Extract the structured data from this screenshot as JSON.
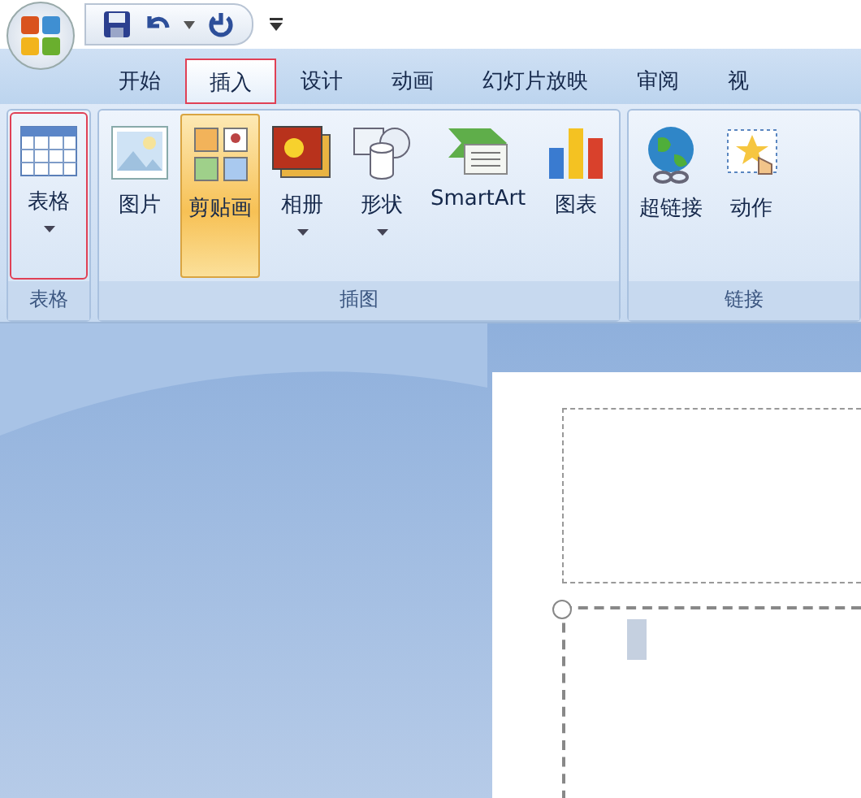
{
  "tabs": [
    {
      "label": "开始",
      "selected": false,
      "marked": false
    },
    {
      "label": "插入",
      "selected": true,
      "marked": true
    },
    {
      "label": "设计",
      "selected": false,
      "marked": false
    },
    {
      "label": "动画",
      "selected": false,
      "marked": false
    },
    {
      "label": "幻灯片放映",
      "selected": false,
      "marked": false
    },
    {
      "label": "审阅",
      "selected": false,
      "marked": false
    },
    {
      "label": "视",
      "selected": false,
      "marked": false
    }
  ],
  "groups": [
    {
      "label": "表格",
      "buttons": [
        {
          "label": "表格",
          "kind": "table",
          "dropdown": true,
          "selected": false,
          "marked": true
        }
      ]
    },
    {
      "label": "插图",
      "buttons": [
        {
          "label": "图片",
          "kind": "picture",
          "dropdown": false,
          "selected": false,
          "marked": false
        },
        {
          "label": "剪贴画",
          "kind": "clipart",
          "dropdown": false,
          "selected": true,
          "marked": false
        },
        {
          "label": "相册",
          "kind": "album",
          "dropdown": true,
          "selected": false,
          "marked": false
        },
        {
          "label": "形状",
          "kind": "shapes",
          "dropdown": true,
          "selected": false,
          "marked": false
        },
        {
          "label": "SmartArt",
          "kind": "smartart",
          "dropdown": false,
          "selected": false,
          "marked": false
        },
        {
          "label": "图表",
          "kind": "chart",
          "dropdown": false,
          "selected": false,
          "marked": false
        }
      ]
    },
    {
      "label": "链接",
      "buttons": [
        {
          "label": "超链接",
          "kind": "globe",
          "dropdown": false,
          "selected": false,
          "marked": false
        },
        {
          "label": "动作",
          "kind": "action",
          "dropdown": false,
          "selected": false,
          "marked": false
        }
      ]
    }
  ]
}
